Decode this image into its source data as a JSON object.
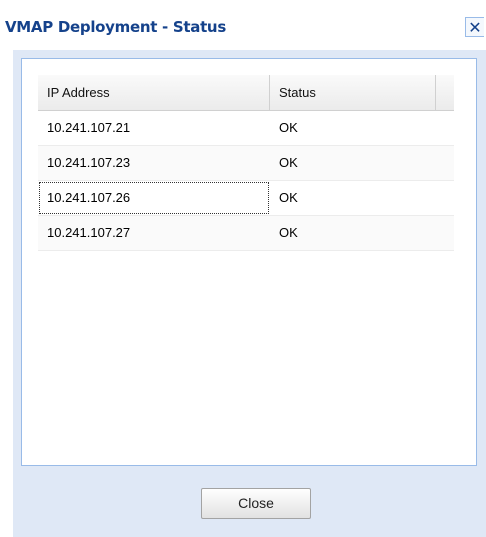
{
  "window": {
    "title": "VMAP Deployment - Status",
    "close_icon": "✕",
    "colors": {
      "title_text": "#15428b",
      "frame_background": "#dfe8f6",
      "border": "#99bbe8"
    }
  },
  "grid": {
    "columns": [
      "IP Address",
      "Status"
    ],
    "rows": [
      {
        "ip": "10.241.107.21",
        "status": "OK"
      },
      {
        "ip": "10.241.107.23",
        "status": "OK"
      },
      {
        "ip": "10.241.107.26",
        "status": "OK"
      },
      {
        "ip": "10.241.107.27",
        "status": "OK"
      }
    ]
  },
  "footer": {
    "close_label": "Close"
  }
}
